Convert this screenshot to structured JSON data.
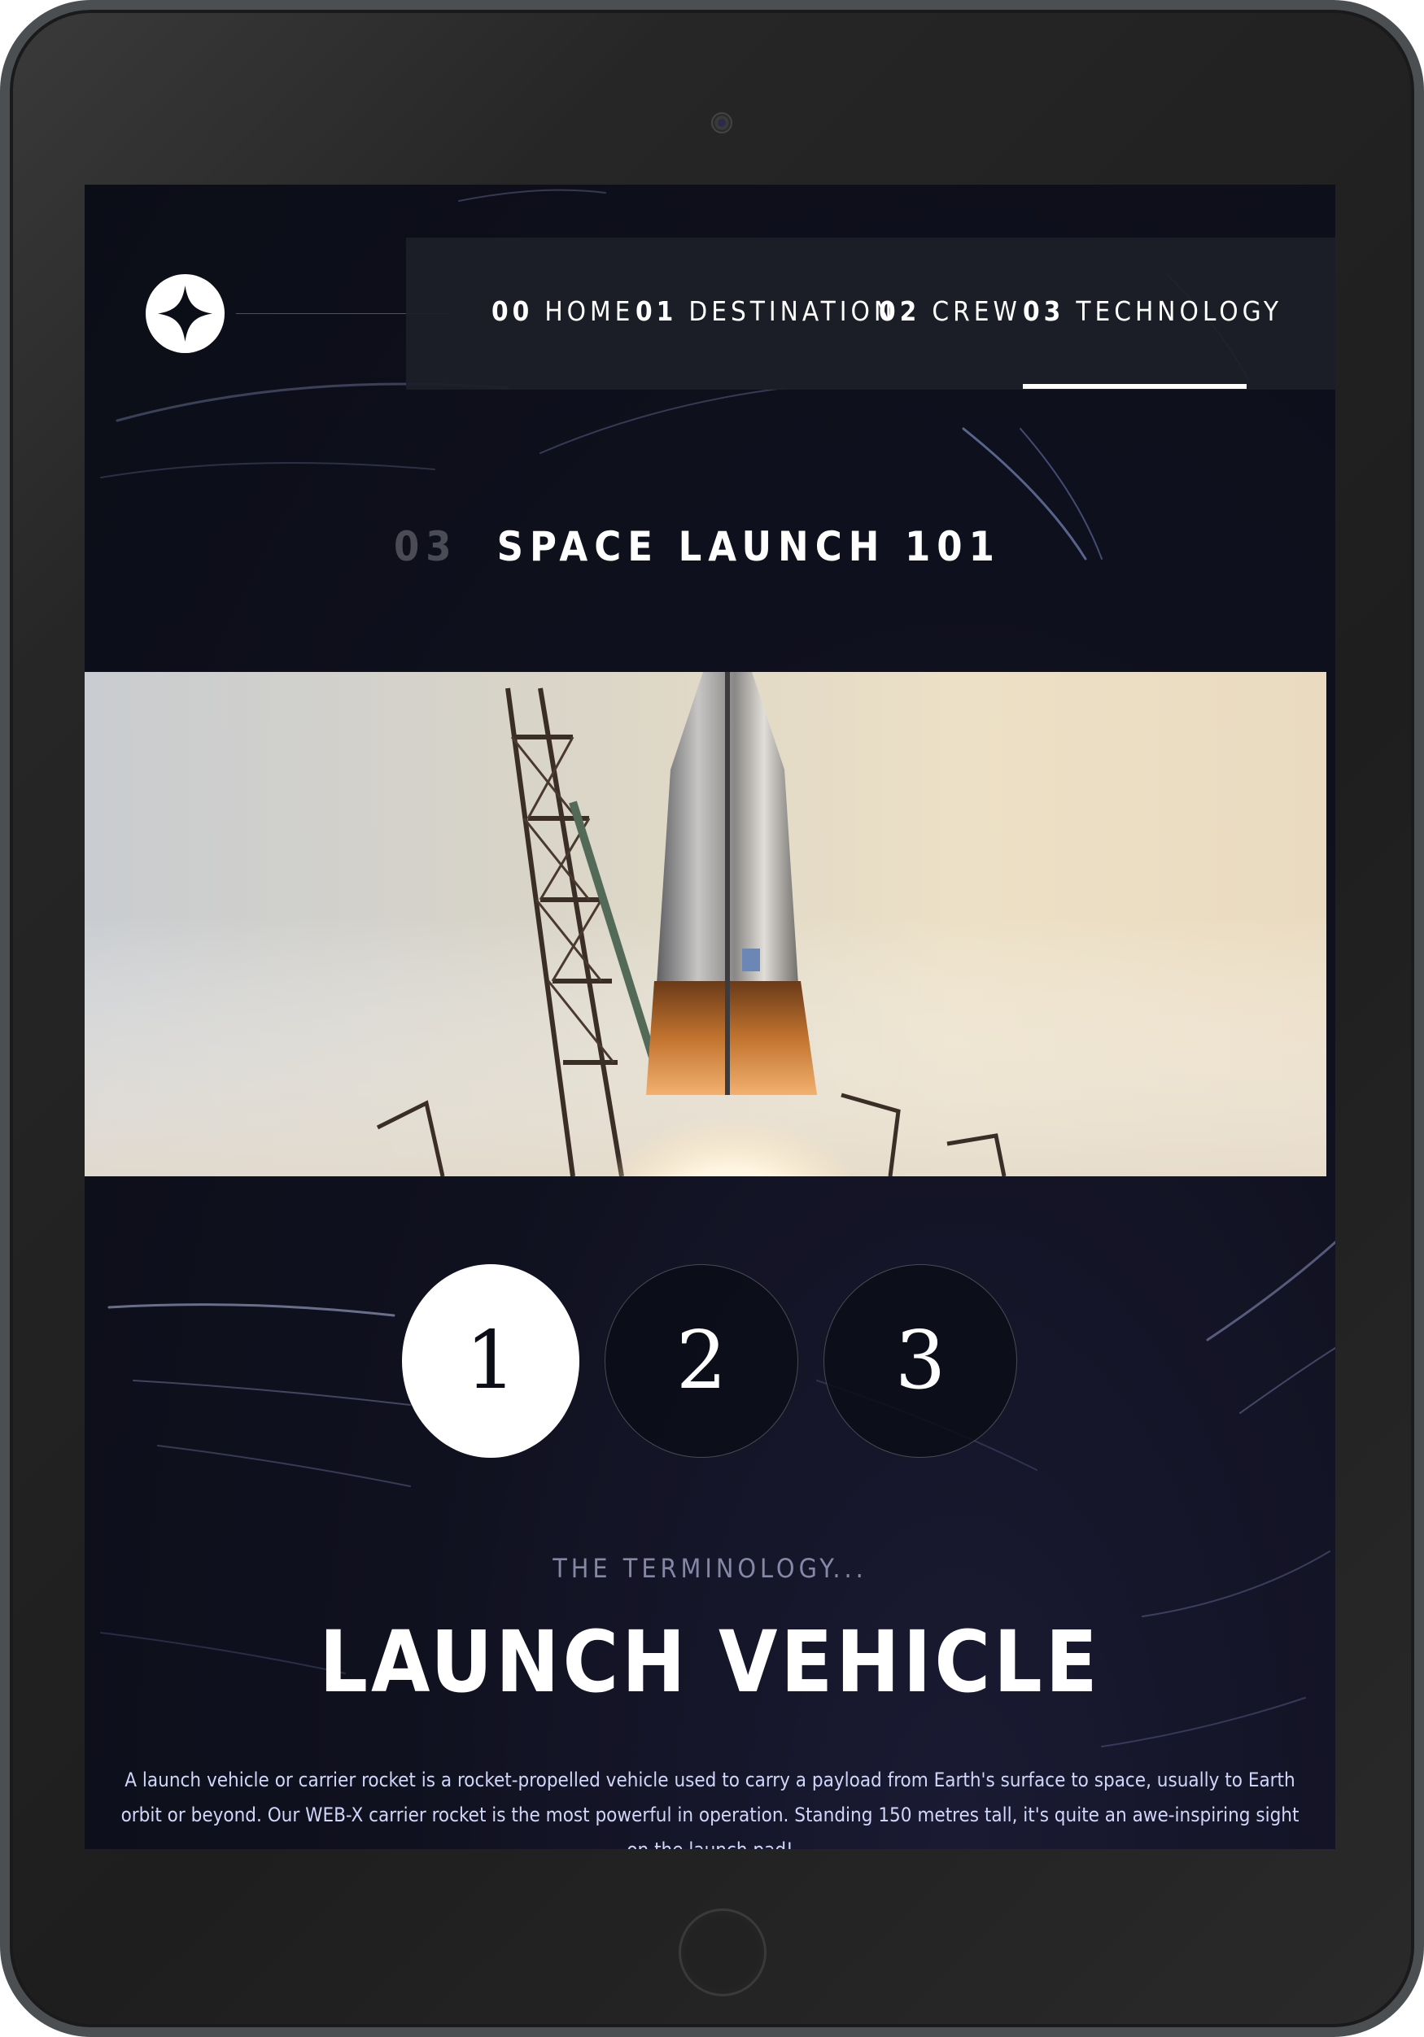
{
  "nav": {
    "items": [
      {
        "number": "00",
        "label": "HOME"
      },
      {
        "number": "01",
        "label": "DESTINATION"
      },
      {
        "number": "02",
        "label": "CREW"
      },
      {
        "number": "03",
        "label": "TECHNOLOGY"
      }
    ],
    "active_index": 3
  },
  "logo": {
    "icon": "four-point-star-icon"
  },
  "page": {
    "heading_number": "03",
    "heading_text": "SPACE LAUNCH 101"
  },
  "image": {
    "subject": "rocket-launch-photo"
  },
  "steps": {
    "items": [
      "1",
      "2",
      "3"
    ],
    "active_index": 0
  },
  "content": {
    "eyebrow": "THE TERMINOLOGY...",
    "title": "LAUNCH VEHICLE",
    "description": "A launch vehicle or carrier rocket is a rocket-propelled vehicle used to carry a payload from Earth's surface to space, usually to Earth orbit or beyond. Our WEB-X carrier rocket is the most powerful in operation. Standing 150 metres tall, it's quite an awe-inspiring sight on the launch pad!"
  },
  "colors": {
    "background": "#0b0d17",
    "accent": "#d0d6f9",
    "text": "#ffffff"
  }
}
